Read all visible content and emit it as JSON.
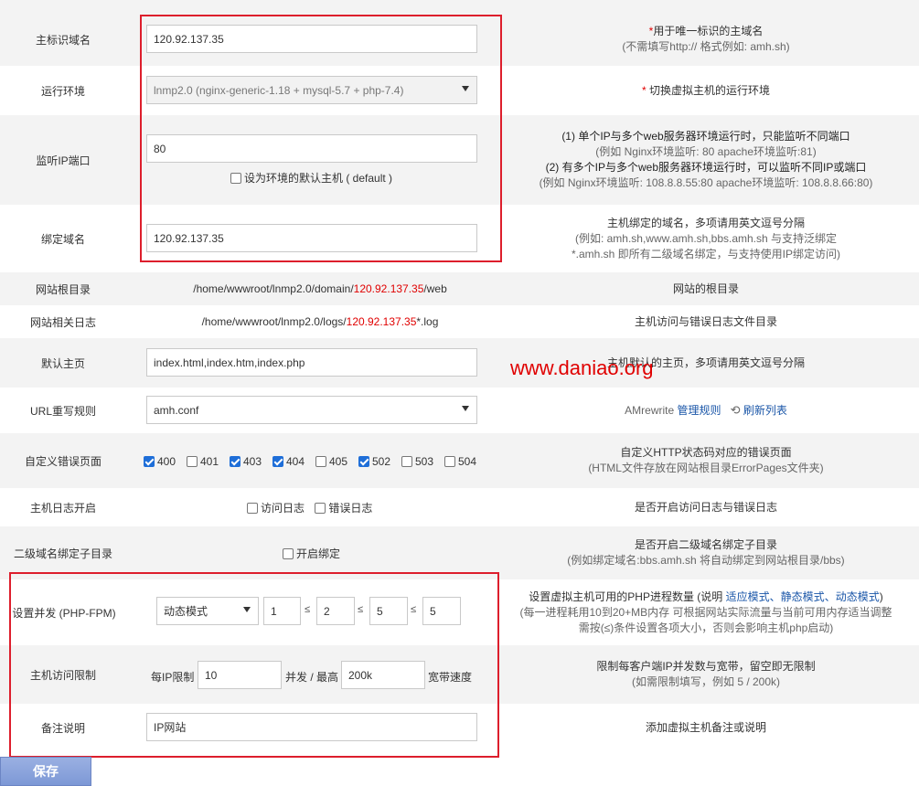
{
  "rows": {
    "primary_domain": {
      "label": "主标识域名",
      "value": "120.92.137.35",
      "note_star": "*",
      "note_line1": "用于唯一标识的主域名",
      "note_line2": "(不需填写http:// 格式例如: amh.sh)"
    },
    "environment": {
      "label": "运行环境",
      "value": "lnmp2.0 (nginx-generic-1.18 + mysql-5.7 + php-7.4)",
      "note_star": "*",
      "note_line1": "切换虚拟主机的运行环境"
    },
    "listen_port": {
      "label": "监听IP端口",
      "value": "80",
      "default_checkbox_label": "设为环境的默认主机 ( default )",
      "note_line1": "(1) 单个IP与多个web服务器环境运行时，只能监听不同端口",
      "note_line2": "(例如 Nginx环境监听: 80   apache环境监听:81)",
      "note_line3": "(2) 有多个IP与多个web服务器环境运行时，可以监听不同IP或端口",
      "note_line4": "(例如 Nginx环境监听: 108.8.8.55:80   apache环境监听: 108.8.8.66:80)"
    },
    "bind_domain": {
      "label": "绑定域名",
      "value": "120.92.137.35",
      "note_line1": "主机绑定的域名，多项请用英文逗号分隔",
      "note_line2": "(例如: amh.sh,www.amh.sh,bbs.amh.sh 与支持泛绑定",
      "note_line3": "*.amh.sh 即所有二级域名绑定，与支持使用IP绑定访问)"
    },
    "web_root": {
      "label": "网站根目录",
      "path_prefix": "/home/wwwroot/lnmp2.0/domain/",
      "path_domain": "120.92.137.35",
      "path_suffix": "/web",
      "note_line1": "网站的根目录"
    },
    "log_dir": {
      "label": "网站相关日志",
      "path_prefix": "/home/wwwroot/lnmp2.0/logs/",
      "path_domain": "120.92.137.35",
      "path_suffix": "*.log",
      "note_line1": "主机访问与错误日志文件目录"
    },
    "default_index": {
      "label": "默认主页",
      "value": "index.html,index.htm,index.php",
      "note_line1": "主机默认的主页，多项请用英文逗号分隔"
    },
    "rewrite": {
      "label": "URL重写规则",
      "value": "amh.conf",
      "note_prefix": "AMrewrite",
      "note_link1": "管理规则",
      "note_link2": "刷新列表"
    },
    "error_pages": {
      "label": "自定义错误页面",
      "codes": [
        {
          "code": "400",
          "checked": true
        },
        {
          "code": "401",
          "checked": false
        },
        {
          "code": "403",
          "checked": true
        },
        {
          "code": "404",
          "checked": true
        },
        {
          "code": "405",
          "checked": false
        },
        {
          "code": "502",
          "checked": true
        },
        {
          "code": "503",
          "checked": false
        },
        {
          "code": "504",
          "checked": false
        }
      ],
      "note_line1": "自定义HTTP状态码对应的错误页面",
      "note_line2": "(HTML文件存放在网站根目录ErrorPages文件夹)"
    },
    "host_logs": {
      "label": "主机日志开启",
      "access_log": "访问日志",
      "error_log": "错误日志",
      "note_line1": "是否开启访问日志与错误日志"
    },
    "subdomain": {
      "label": "二级域名绑定子目录",
      "checkbox_label": "开启绑定",
      "note_line1": "是否开启二级域名绑定子目录",
      "note_line2": "(例如绑定域名:bbs.amh.sh 将自动绑定到网站根目录/bbs)"
    },
    "php_fpm": {
      "label": "设置并发 (PHP-FPM)",
      "mode": "动态模式",
      "v1": "1",
      "v2": "2",
      "v3": "5",
      "v4": "5",
      "le": "≤",
      "note_pre": "设置虚拟主机可用的PHP进程数量 (说明",
      "note_l1": "适应模式",
      "note_sep1": "、",
      "note_l2": "静态模式",
      "note_sep2": "、",
      "note_l3": "动态模式",
      "note_post": ")",
      "note_line2": "(每一进程耗用10到20+MB内存 可根据网站实际流量与当前可用内存适当调整",
      "note_line3": "需按(≤)条件设置各项大小，否则会影响主机php启动)"
    },
    "limit": {
      "label": "主机访问限制",
      "per_ip": "每IP限制",
      "ip_value": "10",
      "middle": "并发 / 最高",
      "bw_value": "200k",
      "suffix": "宽带速度",
      "note_line1": "限制每客户端IP并发数与宽带，留空即无限制",
      "note_line2": "(如需限制填写，例如 5 / 200k)"
    },
    "remark": {
      "label": "备注说明",
      "value": "IP网站",
      "note_line1": "添加虚拟主机备注或说明"
    }
  },
  "save_button": "保存",
  "watermark": "www.daniao.org",
  "colors": {
    "accent_red": "#e00000",
    "highlight_box": "#dd1e2c",
    "link_blue": "#1a56a8",
    "checkbox_blue": "#1e6ed8"
  }
}
